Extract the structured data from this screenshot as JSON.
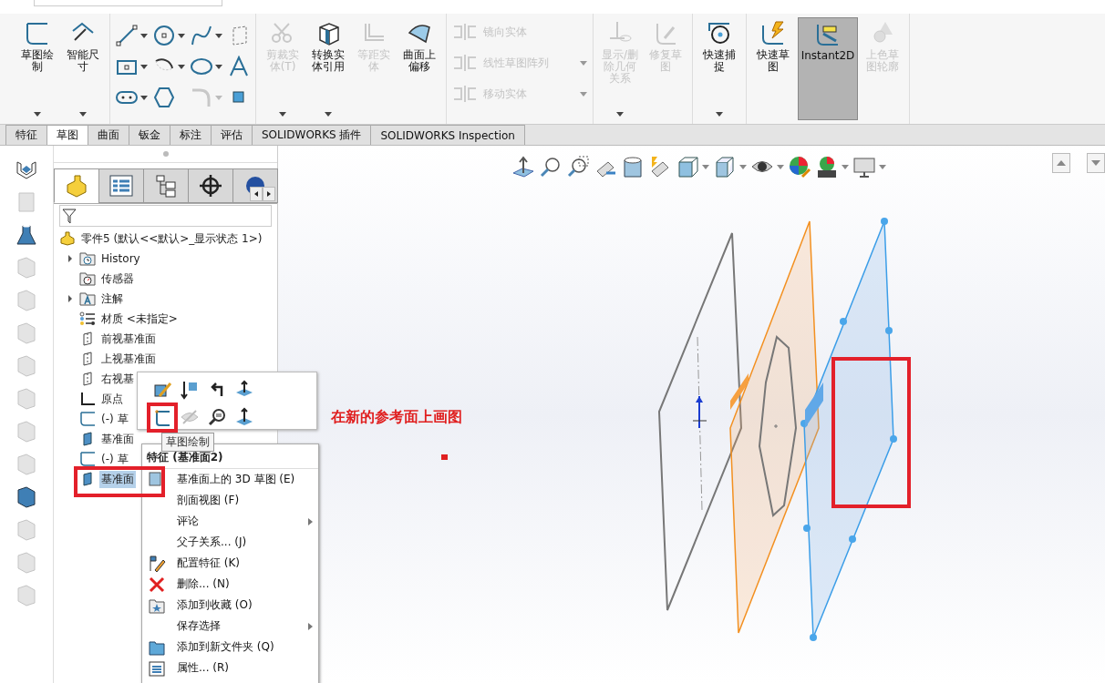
{
  "ribbon": {
    "groups": [
      {
        "kind": "large",
        "tools": [
          {
            "label": "草图绘制",
            "disabled": false,
            "dropdown": true
          },
          {
            "label": "智能尺寸",
            "disabled": false,
            "dropdown": true
          }
        ]
      },
      {
        "kind": "grid",
        "tools": [
          {
            "disabled": false,
            "dropdown": true
          },
          {
            "disabled": false,
            "dropdown": true
          },
          {
            "disabled": false,
            "dropdown": true
          },
          {
            "disabled": false,
            "dropdown": false
          },
          {
            "disabled": false,
            "dropdown": true
          },
          {
            "disabled": false,
            "dropdown": true
          },
          {
            "disabled": false,
            "dropdown": true
          },
          {
            "disabled": false,
            "dropdown": false
          },
          {
            "disabled": false,
            "dropdown": true
          },
          {
            "disabled": false,
            "dropdown": false
          },
          {
            "disabled": true,
            "dropdown": true
          },
          {
            "disabled": false,
            "dropdown": false
          }
        ]
      },
      {
        "kind": "large",
        "tools": [
          {
            "label": "剪裁实体(T)",
            "disabled": true,
            "dropdown": true
          },
          {
            "label": "转换实体引用",
            "disabled": false,
            "dropdown": true
          },
          {
            "label": "等距实体",
            "disabled": true,
            "dropdown": false
          },
          {
            "label": "曲面上偏移",
            "disabled": false,
            "dropdown": false
          }
        ]
      },
      {
        "kind": "small",
        "tools": [
          {
            "label": "镜向实体",
            "disabled": true,
            "dropdown": false
          },
          {
            "label": "线性草图阵列",
            "disabled": true,
            "dropdown": true
          },
          {
            "label": "移动实体",
            "disabled": true,
            "dropdown": true
          }
        ]
      },
      {
        "kind": "large",
        "tools": [
          {
            "label": "显示/删除几何关系",
            "disabled": true,
            "dropdown": true
          },
          {
            "label": "修复草图",
            "disabled": true,
            "dropdown": false
          }
        ]
      },
      {
        "kind": "large",
        "tools": [
          {
            "label": "快速捕捉",
            "disabled": false,
            "dropdown": true
          }
        ]
      },
      {
        "kind": "large",
        "tools": [
          {
            "label": "快速草图",
            "disabled": false,
            "dropdown": false,
            "selected": false
          },
          {
            "label": "Instant2D",
            "disabled": false,
            "dropdown": false,
            "selected": true
          },
          {
            "label": "上色草图轮廓",
            "disabled": true,
            "dropdown": false,
            "selected": false
          }
        ]
      }
    ]
  },
  "tabs": [
    {
      "label": "特征",
      "selected": false
    },
    {
      "label": "草图",
      "selected": true
    },
    {
      "label": "曲面",
      "selected": false
    },
    {
      "label": "钣金",
      "selected": false
    },
    {
      "label": "标注",
      "selected": false
    },
    {
      "label": "评估",
      "selected": false
    },
    {
      "label": "SOLIDWORKS 插件",
      "selected": false
    },
    {
      "label": "SOLIDWORKS Inspection",
      "selected": false
    }
  ],
  "side_strip": [
    {
      "disabled": false
    },
    {
      "disabled": true
    },
    {
      "disabled": false
    },
    {
      "disabled": true
    },
    {
      "disabled": true
    },
    {
      "disabled": true
    },
    {
      "disabled": true
    },
    {
      "disabled": true
    },
    {
      "disabled": true
    },
    {
      "disabled": true
    },
    {
      "disabled": false
    },
    {
      "disabled": true
    },
    {
      "disabled": true
    },
    {
      "disabled": true
    }
  ],
  "tree": {
    "panel_tabs": [
      {
        "selected": true
      },
      {
        "selected": false
      },
      {
        "selected": false
      },
      {
        "selected": false
      },
      {
        "selected": false
      }
    ],
    "root": {
      "label": "零件5  (默认<<默认>_显示状态 1>)",
      "children": [
        {
          "label": "History",
          "kind": "history",
          "expanded": false,
          "selected": false
        },
        {
          "label": "传感器",
          "kind": "sensor",
          "selected": false
        },
        {
          "label": "注解",
          "kind": "annotation",
          "expanded": false,
          "selected": false
        },
        {
          "label": "材质 <未指定>",
          "kind": "material",
          "selected": false
        },
        {
          "label": "前视基准面",
          "kind": "plane",
          "selected": false
        },
        {
          "label": "上视基准面",
          "kind": "plane",
          "selected": false
        },
        {
          "label": "右视基",
          "kind": "plane",
          "selected": false
        },
        {
          "label": "原点",
          "kind": "origin",
          "selected": false
        },
        {
          "label": "(-) 草",
          "kind": "sketch",
          "selected": false
        },
        {
          "label": "基准面",
          "kind": "refplane",
          "selected": false
        },
        {
          "label": "(-) 草",
          "kind": "sketch",
          "selected": false
        },
        {
          "label": "基准面",
          "kind": "refplane",
          "selected": true
        }
      ]
    }
  },
  "context": {
    "tooltip": "草图绘制",
    "header": "特征 (基准面2)",
    "menu": [
      {
        "label": "基准面上的 3D 草图 (E)",
        "submenu": false
      },
      {
        "label": "剖面视图 (F)",
        "submenu": false
      },
      {
        "label": "评论",
        "submenu": true
      },
      {
        "label": "父子关系... (J)",
        "submenu": false
      },
      {
        "label": "配置特征 (K)",
        "submenu": false
      },
      {
        "label": "删除... (N)",
        "submenu": false
      },
      {
        "label": "添加到收藏 (O)",
        "submenu": false
      },
      {
        "label": "保存选择",
        "submenu": true
      },
      {
        "label": "添加到新文件夹 (Q)",
        "submenu": false
      },
      {
        "label": "属性... (R)",
        "submenu": false
      }
    ]
  },
  "view_toolbar": [
    {
      "dropdown": false
    },
    {
      "dropdown": false
    },
    {
      "dropdown": false
    },
    {
      "dropdown": false
    },
    {
      "dropdown": false
    },
    {
      "dropdown": false
    },
    {
      "dropdown": true
    },
    {
      "dropdown": true
    },
    {
      "dropdown": true
    },
    {
      "dropdown": false
    },
    {
      "dropdown": true
    },
    {
      "dropdown": true
    }
  ],
  "annotation": {
    "note": "在新的参考面上画图"
  }
}
